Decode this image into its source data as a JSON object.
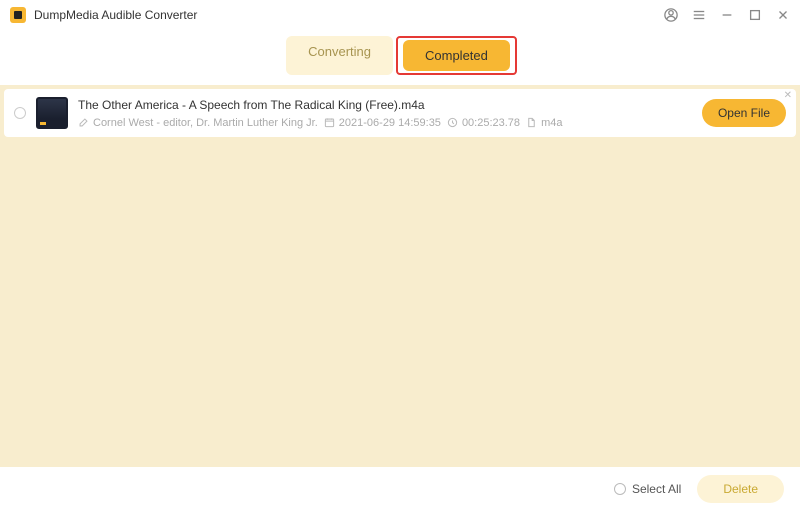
{
  "app": {
    "title": "DumpMedia Audible Converter"
  },
  "tabs": {
    "converting": "Converting",
    "completed": "Completed"
  },
  "items": [
    {
      "title": "The Other America - A Speech from The Radical King (Free).m4a",
      "author": "Cornel West - editor, Dr. Martin Luther King Jr.",
      "date": "2021-06-29 14:59:35",
      "duration": "00:25:23.78",
      "format": "m4a",
      "open_label": "Open File"
    }
  ],
  "footer": {
    "select_all": "Select All",
    "delete": "Delete"
  }
}
